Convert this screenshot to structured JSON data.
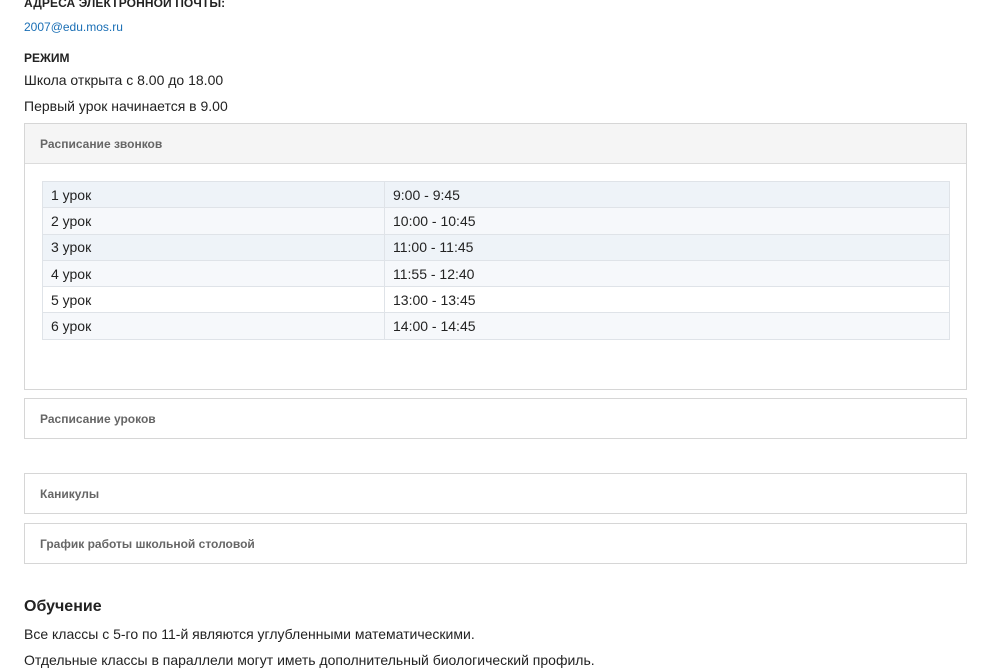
{
  "contacts": {
    "email_heading": "АДРЕСА ЭЛЕКТРОННОЙ ПОЧТЫ:",
    "email": "2007@edu.mos.ru"
  },
  "mode": {
    "heading": "РЕЖИМ",
    "lines": [
      "Школа открыта с 8.00 до 18.00",
      "Первый урок начинается в 9.00"
    ]
  },
  "panels": {
    "bells": {
      "title": "Расписание звонков",
      "rows": [
        {
          "lesson": "1 урок",
          "time": "9:00 - 9:45"
        },
        {
          "lesson": "2 урок",
          "time": "10:00 - 10:45"
        },
        {
          "lesson": "3 урок",
          "time": "11:00 - 11:45"
        },
        {
          "lesson": "4 урок",
          "time": "11:55 - 12:40"
        },
        {
          "lesson": "5 урок",
          "time": "13:00 - 13:45"
        },
        {
          "lesson": "6 урок",
          "time": "14:00 - 14:45"
        }
      ]
    },
    "lessons": {
      "title": "Расписание уроков"
    },
    "holidays": {
      "title": "Каникулы"
    },
    "canteen": {
      "title": "График работы школьной столовой"
    }
  },
  "education": {
    "heading": "Обучение",
    "lines": [
      "Все классы с 5-го по 11-й являются углубленными математическими.",
      "Отдельные классы в параллели могут иметь дополнительный биологический профиль."
    ]
  }
}
